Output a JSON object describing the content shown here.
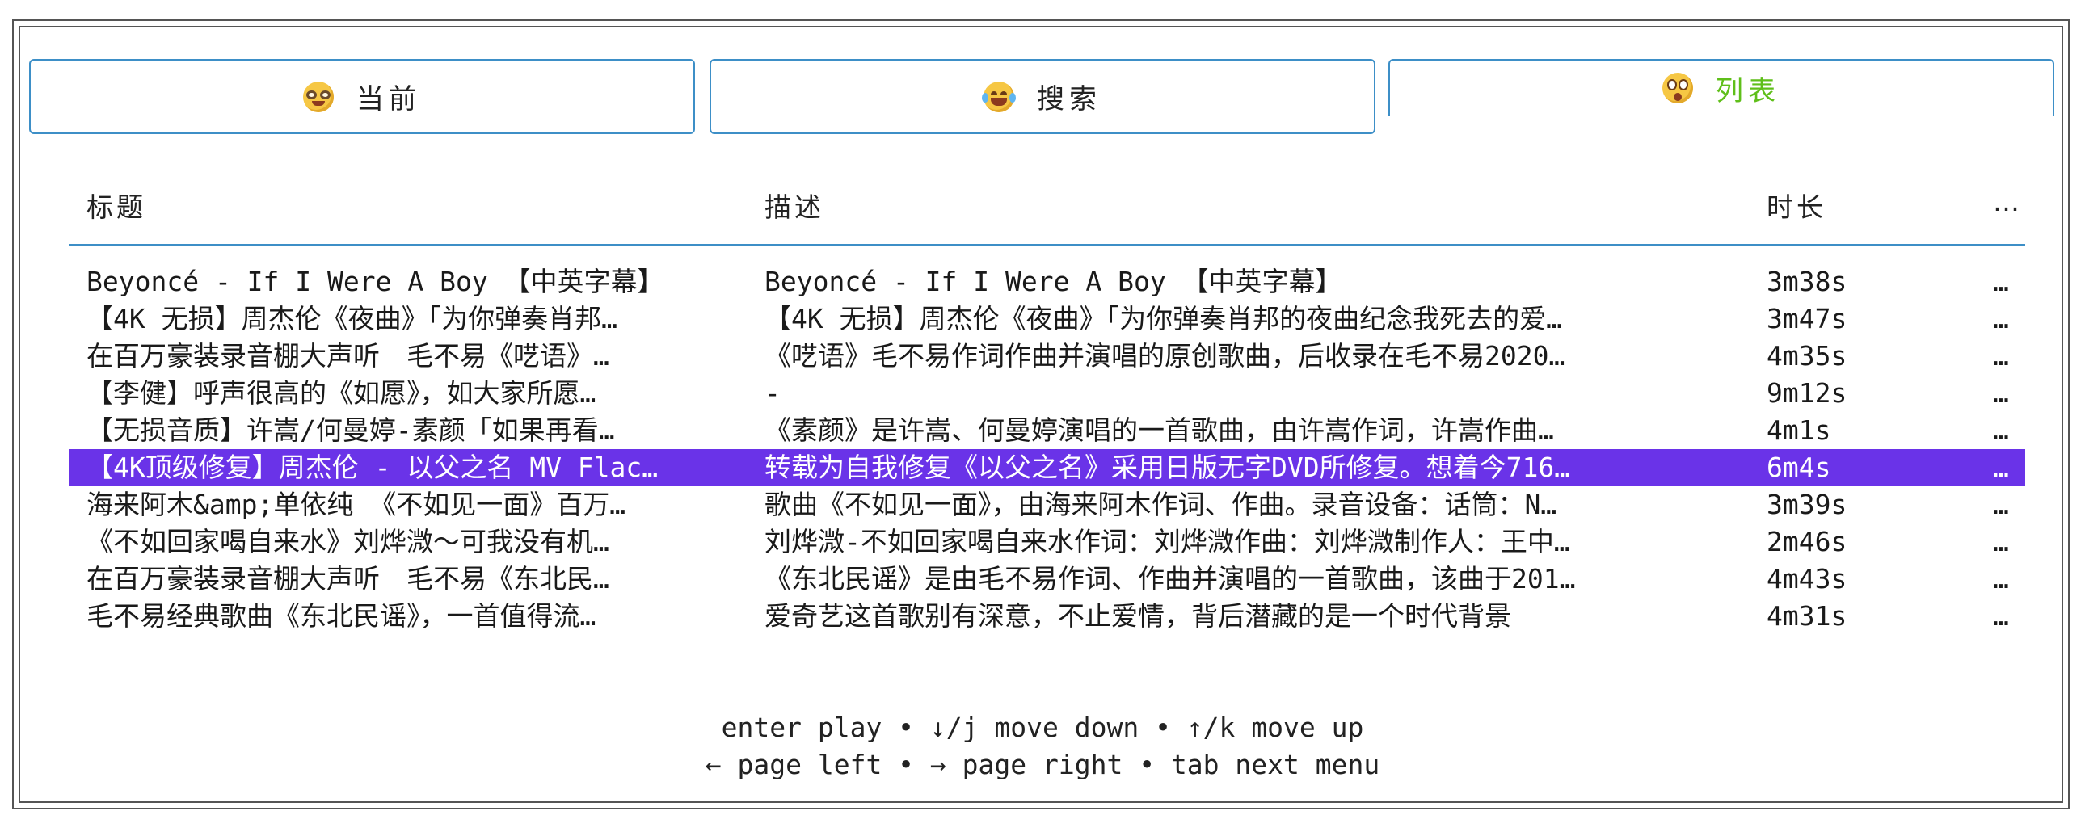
{
  "tabs": [
    {
      "label": "当前",
      "icon": "nerd-face-emoji",
      "active": false
    },
    {
      "label": "搜索",
      "icon": "tears-of-joy-emoji",
      "active": false
    },
    {
      "label": "列表",
      "icon": "flushed-face-emoji",
      "active": true
    }
  ],
  "colors": {
    "accent_border": "#3d8fc7",
    "active_tab_text": "#5fbf1a",
    "selected_row_bg": "#6a33e8"
  },
  "table": {
    "headers": {
      "title": "标题",
      "desc": "描述",
      "duration": "时长",
      "more": "…"
    },
    "rows": [
      {
        "title": "Beyoncé - If I Were A Boy 【中英字幕】",
        "desc": "Beyoncé - If I Were A Boy 【中英字幕】",
        "duration": "3m38s",
        "more": "…"
      },
      {
        "title": "【4K 无损】周杰伦《夜曲》「为你弹奏肖邦…",
        "desc": "【4K 无损】周杰伦《夜曲》「为你弹奏肖邦的夜曲纪念我死去的爱…",
        "duration": "3m47s",
        "more": "…"
      },
      {
        "title": "在百万豪装录音棚大声听　毛不易《呓语》…",
        "desc": "《呓语》毛不易作词作曲并演唱的原创歌曲，后收录在毛不易2020…",
        "duration": "4m35s",
        "more": "…"
      },
      {
        "title": "【李健】呼声很高的《如愿》，如大家所愿…",
        "desc": "-",
        "duration": "9m12s",
        "more": "…"
      },
      {
        "title": "【无损音质】许嵩/何曼婷-素颜「如果再看…",
        "desc": "《素颜》是许嵩、何曼婷演唱的一首歌曲，由许嵩作词，许嵩作曲…",
        "duration": "4m1s",
        "more": "…"
      },
      {
        "title": "【4K顶级修复】周杰伦 - 以父之名 MV Flac…",
        "desc": "转载为自我修复《以父之名》采用日版无字DVD所修复。想着今716…",
        "duration": "6m4s",
        "more": "…",
        "selected": true
      },
      {
        "title": "海来阿木&amp;单依纯 《不如见一面》百万…",
        "desc": "歌曲《不如见一面》，由海来阿木作词、作曲。录音设备：话筒：N…",
        "duration": "3m39s",
        "more": "…"
      },
      {
        "title": "《不如回家喝自来水》刘烨溦～可我没有机…",
        "desc": "刘烨溦-不如回家喝自来水作词：刘烨溦作曲：刘烨溦制作人：王中…",
        "duration": "2m46s",
        "more": "…"
      },
      {
        "title": "在百万豪装录音棚大声听　毛不易《东北民…",
        "desc": "《东北民谣》是由毛不易作词、作曲并演唱的一首歌曲，该曲于201…",
        "duration": "4m43s",
        "more": "…"
      },
      {
        "title": "毛不易经典歌曲《东北民谣》，一首值得流…",
        "desc": "爱奇艺这首歌别有深意，不止爱情，背后潜藏的是一个时代背景",
        "duration": "4m31s",
        "more": "…"
      }
    ]
  },
  "help": {
    "line1": "enter play • ↓/j move down • ↑/k move up",
    "line2": "← page left • → page right • tab next menu"
  }
}
